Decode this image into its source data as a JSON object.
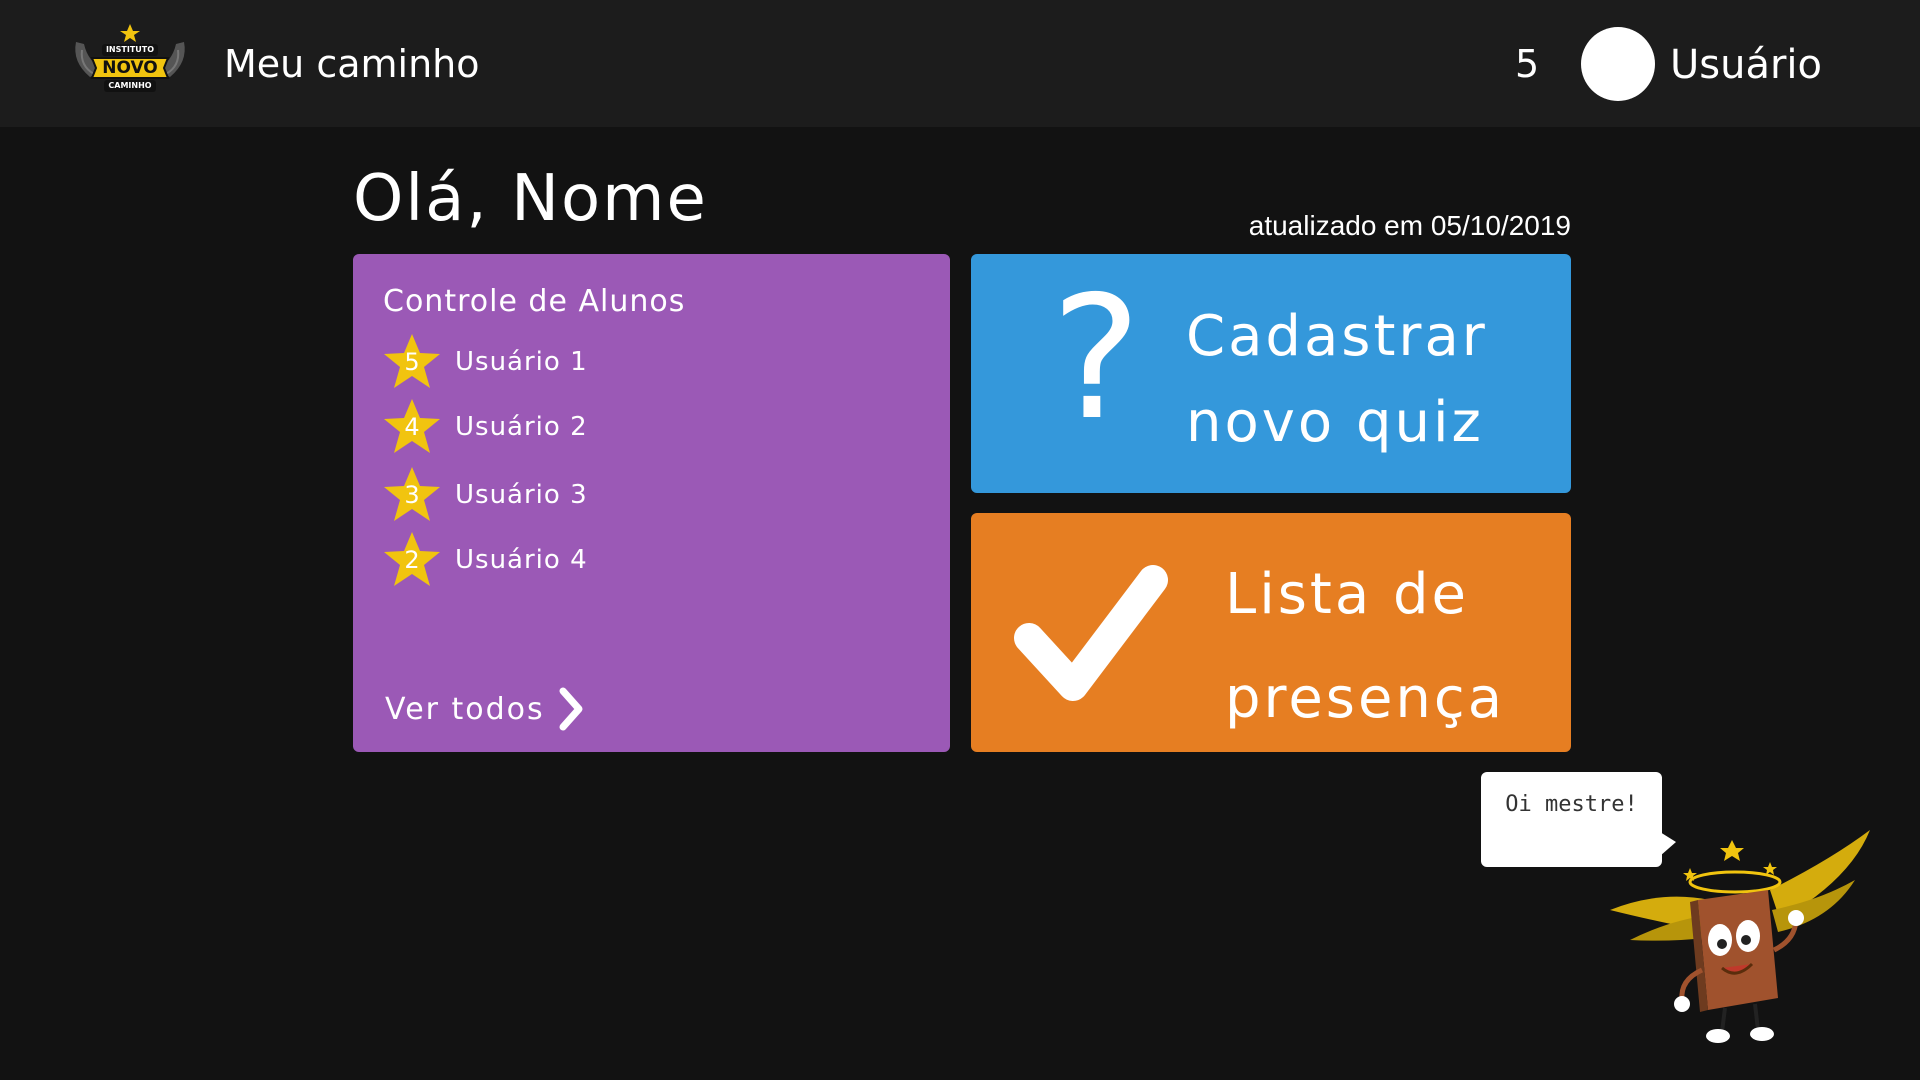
{
  "header": {
    "logo_text_top": "INSTITUTO",
    "logo_text_main": "NOVO",
    "logo_text_bottom": "CAMINHO",
    "app_title": "Meu caminho",
    "coins": "5",
    "user_name": "Usuário"
  },
  "greeting": "Olá, Nome",
  "updated_text": "atualizado em 05/10/2019",
  "students_card": {
    "title": "Controle de Alunos",
    "items": [
      {
        "stars": "5",
        "name": "Usuário 1"
      },
      {
        "stars": "4",
        "name": "Usuário 2"
      },
      {
        "stars": "3",
        "name": "Usuário 3"
      },
      {
        "stars": "2",
        "name": "Usuário 4"
      }
    ],
    "see_all": "Ver todos",
    "color": "#9b59b6"
  },
  "quiz_card": {
    "icon": "?",
    "line1": "Cadastrar",
    "line2": "novo quiz",
    "color": "#3498db"
  },
  "attendance_card": {
    "line1": "Lista de",
    "line2": "presença",
    "color": "#e67e22"
  },
  "mascot": {
    "speech": "Oi mestre!"
  },
  "colors": {
    "background": "#121212",
    "header": "#1c1c1c",
    "star": "#f1c40f"
  }
}
